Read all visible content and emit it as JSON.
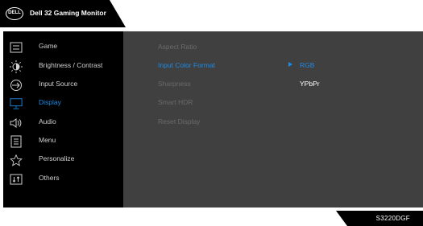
{
  "header": {
    "logo_text": "DELL",
    "title": "Dell 32 Gaming Monitor"
  },
  "sidebar": {
    "items": [
      {
        "label": "Game",
        "icon": "game-icon"
      },
      {
        "label": "Brightness / Contrast",
        "icon": "brightness-icon"
      },
      {
        "label": "Input Source",
        "icon": "input-source-icon"
      },
      {
        "label": "Display",
        "icon": "display-icon",
        "active": true
      },
      {
        "label": "Audio",
        "icon": "audio-icon"
      },
      {
        "label": "Menu",
        "icon": "menu-icon"
      },
      {
        "label": "Personalize",
        "icon": "personalize-icon"
      },
      {
        "label": "Others",
        "icon": "others-icon"
      }
    ]
  },
  "display_menu": {
    "items": [
      {
        "label": "Aspect Ratio"
      },
      {
        "label": "Input Color Format",
        "active": true
      },
      {
        "label": "Sharpness"
      },
      {
        "label": "Smart HDR"
      },
      {
        "label": "Reset Display"
      }
    ],
    "options": [
      {
        "label": "RGB",
        "selected": true
      },
      {
        "label": "YPbPr"
      }
    ]
  },
  "footer": {
    "model": "S3220DGF"
  },
  "colors": {
    "accent": "#1e8ae6",
    "panel_bg": "#404040",
    "sidebar_bg": "#000000"
  }
}
